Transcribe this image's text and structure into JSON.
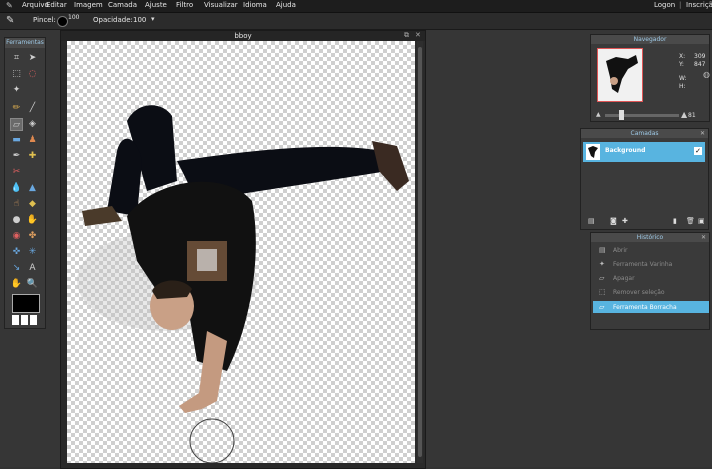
{
  "menu": [
    "Arquivo",
    "Editar",
    "Imagem",
    "Camada",
    "Ajuste",
    "Filtro",
    "Visualizar",
    "Idioma",
    "Ajuda"
  ],
  "account": {
    "login": "Logon",
    "separator": "|",
    "signup": "Inscrição"
  },
  "options": {
    "brush_label": "Pincel:",
    "brush_size": "100",
    "opacity_label": "Opacidade:",
    "opacity_value": "100"
  },
  "tools_panel": {
    "title": "Ferramentas"
  },
  "document": {
    "title": "bboy"
  },
  "navigator": {
    "title": "Navegador",
    "x_label": "X:",
    "x_value": "309",
    "y_label": "Y:",
    "y_value": "847",
    "w_label": "W:",
    "h_label": "H:",
    "zoom": "81"
  },
  "layers": {
    "title": "Camadas",
    "items": [
      {
        "name": "Background",
        "visible": true
      }
    ]
  },
  "history": {
    "title": "Histórico",
    "items": [
      {
        "label": "Abrir",
        "icon": "open-icon"
      },
      {
        "label": "Ferramenta Varinha",
        "icon": "wand-icon"
      },
      {
        "label": "Apagar",
        "icon": "erase-icon"
      },
      {
        "label": "Remover seleção",
        "icon": "deselect-icon"
      },
      {
        "label": "Ferramenta Borracha",
        "icon": "eraser-icon",
        "active": true
      }
    ]
  },
  "colors": {
    "accent": "#58b4e0",
    "panel_title": "#9ec9e6",
    "foreground": "#000000",
    "background": "#ffffff"
  }
}
